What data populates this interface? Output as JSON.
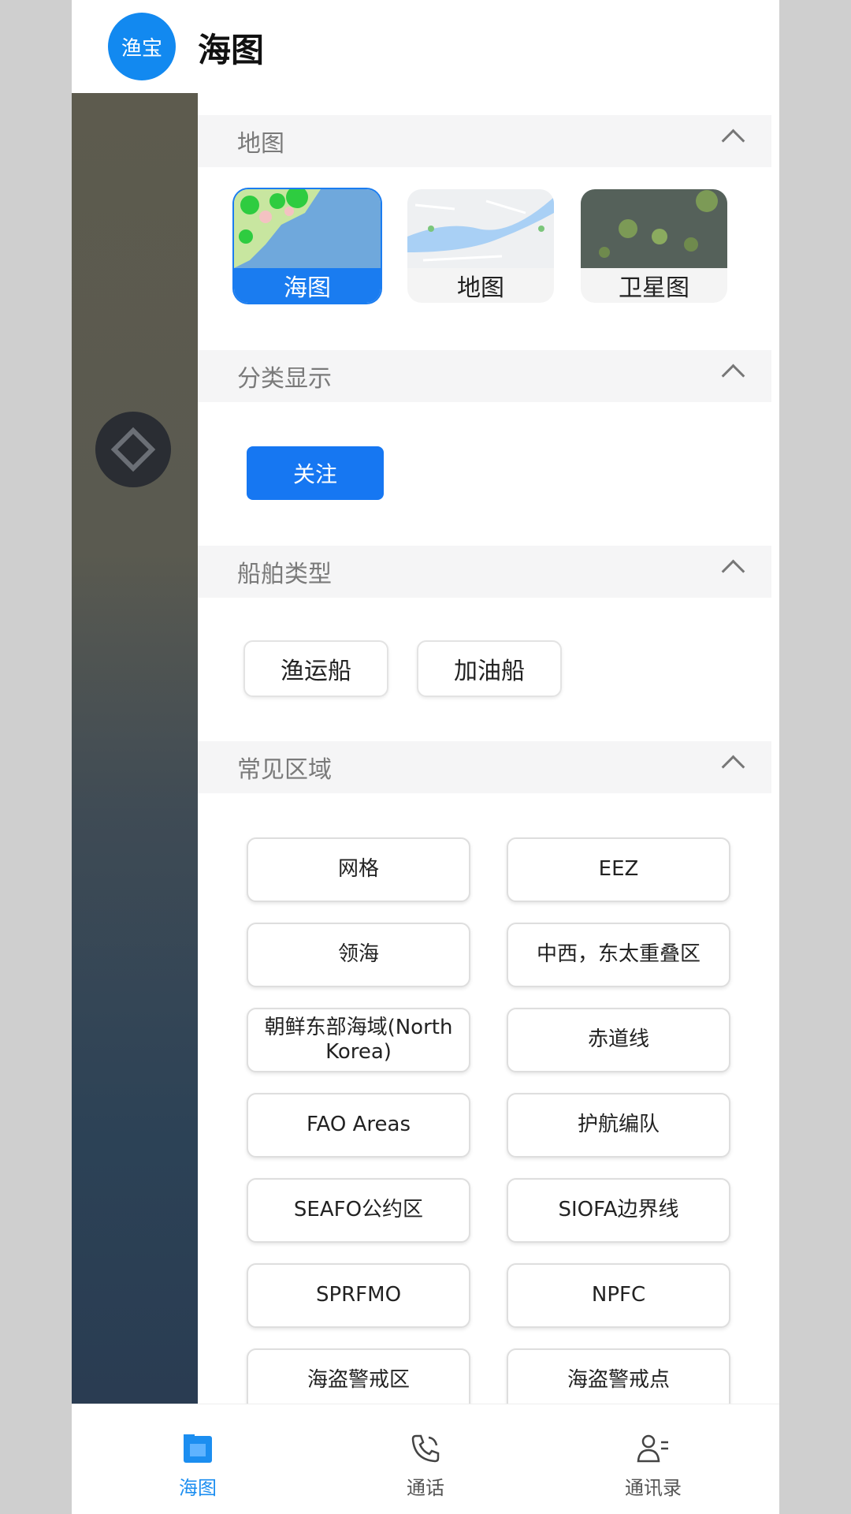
{
  "header": {
    "logo_text": "渔宝",
    "title": "海图"
  },
  "sections": {
    "map": {
      "title": "地图",
      "layers": [
        {
          "label": "海图",
          "selected": true
        },
        {
          "label": "地图",
          "selected": false
        },
        {
          "label": "卫星图",
          "selected": false
        }
      ]
    },
    "category": {
      "title": "分类显示",
      "follow_label": "关注"
    },
    "ship_type": {
      "title": "船舶类型",
      "chips": [
        "渔运船",
        "加油船"
      ]
    },
    "regions": {
      "title": "常见区域",
      "items": [
        "网格",
        "EEZ",
        "领海",
        "中西，东太重叠区",
        "朝鲜东部海域(North Korea)",
        "赤道线",
        "FAO Areas",
        "护航编队",
        "SEAFO公约区",
        "SIOFA边界线",
        "SPRFMO",
        "NPFC",
        "海盗警戒区",
        "海盗警戒点"
      ]
    }
  },
  "bottom_nav": {
    "items": [
      {
        "label": "海图",
        "icon": "chart-icon",
        "active": true
      },
      {
        "label": "通话",
        "icon": "phone-icon",
        "active": false
      },
      {
        "label": "通讯录",
        "icon": "contacts-icon",
        "active": false
      }
    ]
  },
  "colors": {
    "accent": "#1677f2",
    "nav_active": "#1c8ef0"
  }
}
